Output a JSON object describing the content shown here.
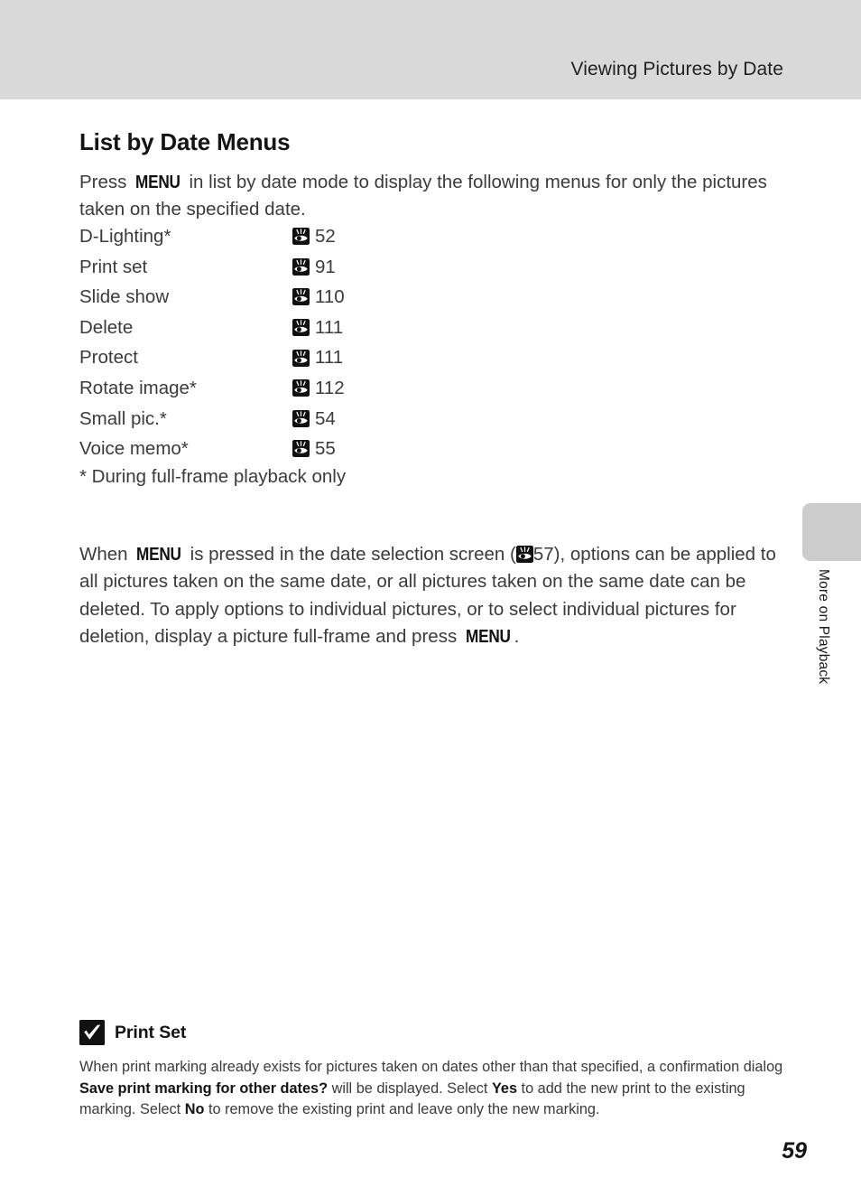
{
  "header": {
    "title": "Viewing Pictures by Date"
  },
  "section": {
    "title": "List by Date Menus",
    "intro_before": "Press ",
    "intro_menu": "MENU",
    "intro_after": " in list by date mode to display the following menus for only the pictures taken on the specified date."
  },
  "menu_list": {
    "items": [
      {
        "label": "D-Lighting*",
        "icon": "reference-eye-icon",
        "page": "52"
      },
      {
        "label": "Print set",
        "icon": "reference-eye-icon",
        "page": "91"
      },
      {
        "label": "Slide show",
        "icon": "reference-eye-icon",
        "page": "110"
      },
      {
        "label": "Delete",
        "icon": "reference-eye-icon",
        "page": "111"
      },
      {
        "label": "Protect",
        "icon": "reference-eye-icon",
        "page": "111"
      },
      {
        "label": "Rotate image*",
        "icon": "reference-eye-icon",
        "page": "112"
      },
      {
        "label": "Small pic.*",
        "icon": "reference-eye-icon",
        "page": "54"
      },
      {
        "label": "Voice memo*",
        "icon": "reference-eye-icon",
        "page": "55"
      }
    ],
    "footnote": "* During full-frame playback only"
  },
  "body_para": {
    "t1": "When ",
    "menu1": "MENU",
    "t2": " is pressed in the date selection screen (",
    "ref_page": "57",
    "t3": "), options can be applied to all pictures taken on the same date, or all pictures taken on the same date can be deleted. To apply options to individual pictures, or to select individual pictures for deletion, display a picture full-frame and press ",
    "menu2": "MENU",
    "t4": "."
  },
  "side_tab": {
    "label": "More on Playback"
  },
  "note": {
    "icon": "checkmark-icon",
    "title": "Print Set",
    "t1": "When print marking already exists for pictures taken on dates other than that specified, a confirmation dialog ",
    "b1": "Save print marking for other dates?",
    "t2": " will be displayed. Select ",
    "b2": "Yes",
    "t3": " to add the new print to the existing marking. Select ",
    "b3": "No",
    "t4": " to remove the existing print and leave only the new marking."
  },
  "footer": {
    "page_number": "59"
  },
  "colors": {
    "header_band": "#d9d9d9",
    "side_tab": "#cccccc",
    "text": "#3b3b3b",
    "heading": "#141414"
  }
}
